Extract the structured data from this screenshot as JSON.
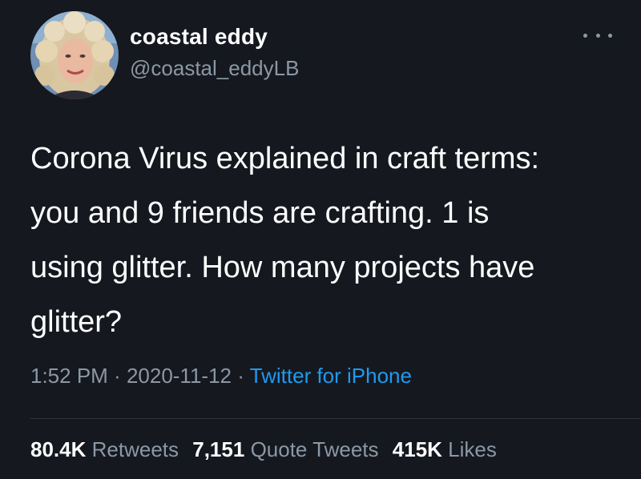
{
  "author": {
    "display_name": "coastal eddy",
    "handle": "@coastal_eddyLB"
  },
  "icons": {
    "more": "more-horizontal-icon",
    "avatar": "profile-photo"
  },
  "tweet": {
    "lines": [
      "Corona Virus explained in craft terms:",
      "you and 9 friends are crafting. 1 is",
      "using glitter. How many projects have",
      "glitter?"
    ]
  },
  "meta": {
    "time": "1:52 PM",
    "separator": " · ",
    "date": "2020-11-12",
    "source": "Twitter for iPhone"
  },
  "stats": {
    "retweets_count": "80.4K",
    "retweets_label": "Retweets",
    "quotes_count": "7,151",
    "quotes_label": "Quote Tweets",
    "likes_count": "415K",
    "likes_label": "Likes"
  },
  "colors": {
    "background": "#15181f",
    "text": "#ffffff",
    "muted": "#8b98a5",
    "link": "#1d9bf0",
    "divider": "#2f3336"
  }
}
